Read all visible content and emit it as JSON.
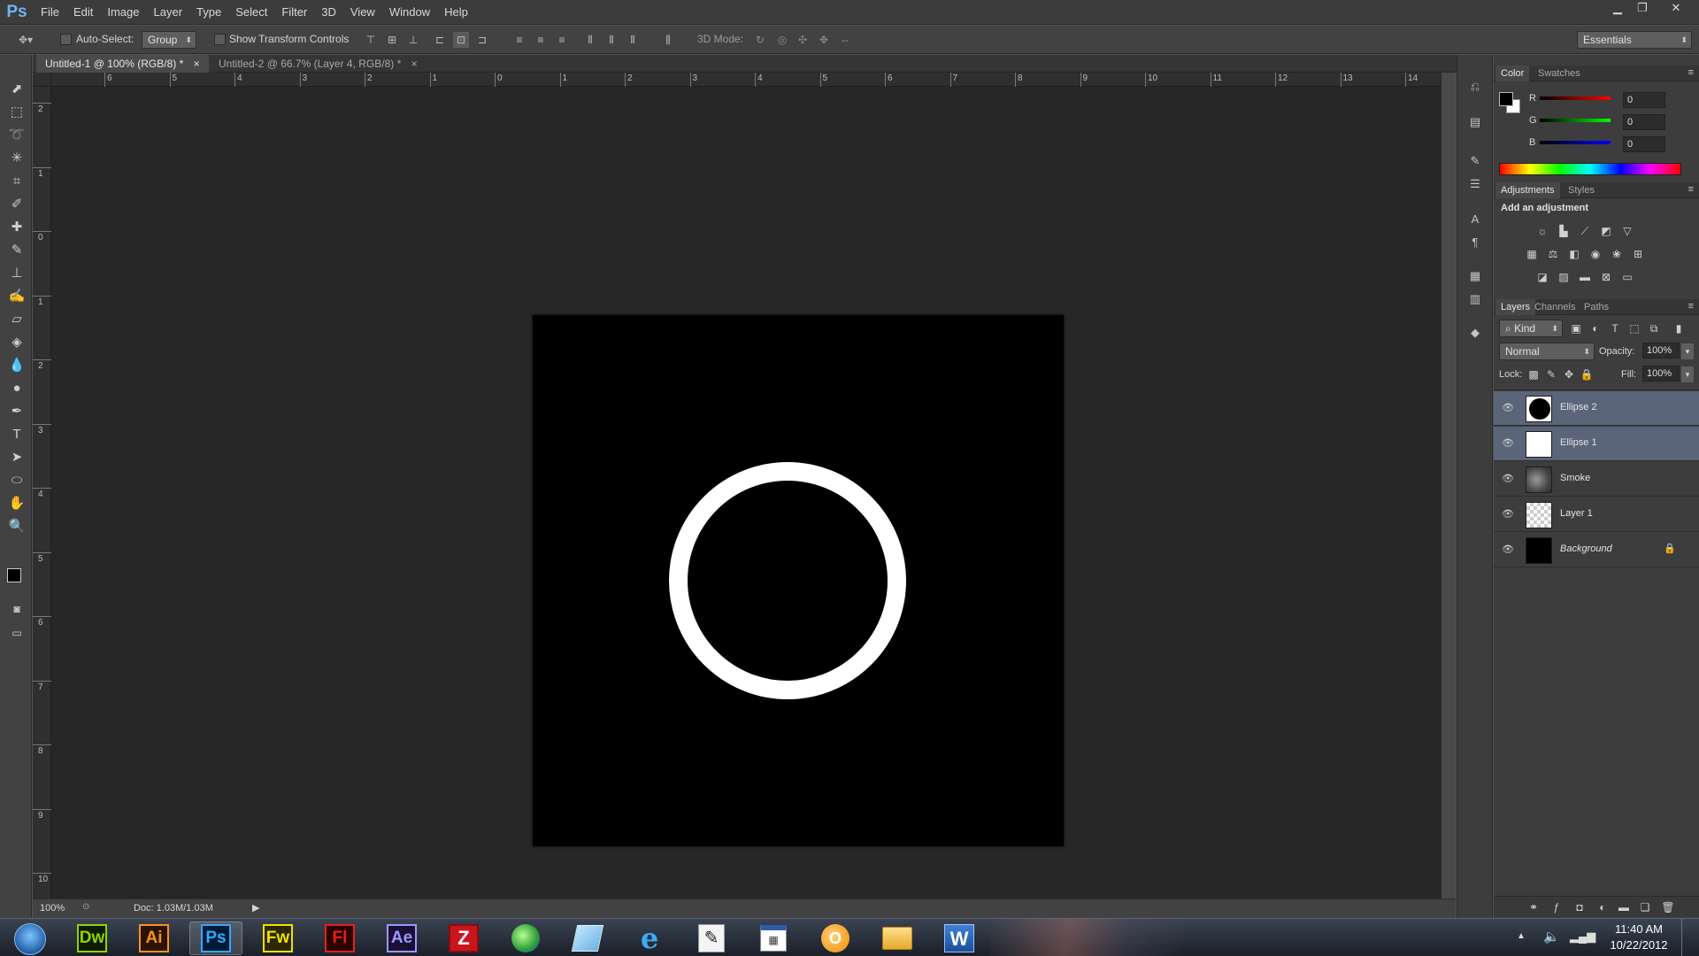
{
  "app": {
    "logo": "Ps"
  },
  "menubar": {
    "items": [
      "File",
      "Edit",
      "Image",
      "Layer",
      "Type",
      "Select",
      "Filter",
      "3D",
      "View",
      "Window",
      "Help"
    ]
  },
  "options": {
    "auto_select_label": "Auto-Select:",
    "auto_select_value": "Group",
    "show_transform_label": "Show Transform Controls",
    "mode_3d_label": "3D Mode:",
    "workspace": "Essentials"
  },
  "doc_tabs": [
    {
      "label": "Untitled-1 @ 100% (RGB/8) *"
    },
    {
      "label": "Untitled-2 @ 66.7% (Layer 4, RGB/8) *"
    }
  ],
  "ruler": {
    "top_labels": [
      "6",
      "5",
      "4",
      "3",
      "2",
      "1",
      "0",
      "1",
      "2",
      "3",
      "4",
      "5",
      "6",
      "7",
      "8",
      "9",
      "10",
      "11",
      "12",
      "13",
      "14"
    ],
    "left_labels": [
      "2",
      "1",
      "0",
      "1",
      "2",
      "3",
      "4",
      "5",
      "6",
      "7",
      "8",
      "9",
      "10"
    ]
  },
  "status": {
    "zoom": "100%",
    "doc": "Doc: 1.03M/1.03M"
  },
  "color_panel": {
    "tabs": [
      "Color",
      "Swatches"
    ],
    "channels": [
      {
        "name": "R",
        "value": "0",
        "color": "#d42a2a"
      },
      {
        "name": "G",
        "value": "0",
        "color": "#2fb02f"
      },
      {
        "name": "B",
        "value": "0",
        "color": "#2a4fd4"
      }
    ]
  },
  "adjustments_panel": {
    "tabs": [
      "Adjustments",
      "Styles"
    ],
    "heading": "Add an adjustment"
  },
  "layers_panel": {
    "tabs": [
      "Layers",
      "Channels",
      "Paths"
    ],
    "filter_kind": "Kind",
    "blend_mode": "Normal",
    "opacity_label": "Opacity:",
    "opacity_value": "100%",
    "lock_label": "Lock:",
    "fill_label": "Fill:",
    "fill_value": "100%",
    "layers": [
      {
        "name": "Ellipse 2",
        "selected": true
      },
      {
        "name": "Ellipse 1",
        "selected": true
      },
      {
        "name": "Smoke",
        "selected": false
      },
      {
        "name": "Layer 1",
        "selected": false
      },
      {
        "name": "Background",
        "selected": false
      }
    ]
  },
  "taskbar": {
    "apps": [
      {
        "label": "Dw",
        "color": "#8fd400"
      },
      {
        "label": "Ai",
        "color": "#f7931e"
      },
      {
        "label": "Ps",
        "color": "#31a8ff"
      },
      {
        "label": "Fw",
        "color": "#f1e100"
      },
      {
        "label": "Fl",
        "color": "#e2231a"
      },
      {
        "label": "Ae",
        "color": "#9999ff"
      }
    ],
    "time": "11:40 AM",
    "date": "10/22/2012"
  }
}
